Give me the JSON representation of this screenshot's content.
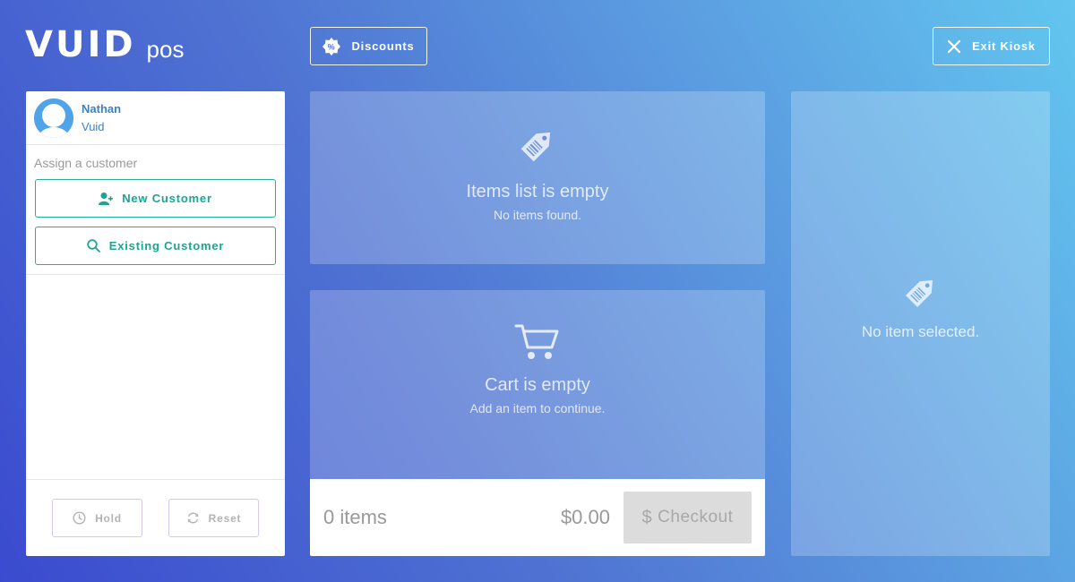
{
  "brand": {
    "logo_text": "VUID",
    "logo_suffix": "pos"
  },
  "header": {
    "discounts_label": "Discounts",
    "exit_label": "Exit Kiosk"
  },
  "user": {
    "name": "Nathan",
    "org": "Vuid"
  },
  "customer": {
    "assign_label": "Assign a customer",
    "new_label": "New Customer",
    "existing_label": "Existing Customer"
  },
  "actions": {
    "hold_label": "Hold",
    "reset_label": "Reset"
  },
  "items_panel": {
    "title": "Items list is empty",
    "subtitle": "No items found."
  },
  "cart_panel": {
    "title": "Cart is empty",
    "subtitle": "Add an item to continue."
  },
  "cart_footer": {
    "item_count": "0 items",
    "total": "$0.00",
    "checkout_label": "Checkout",
    "checkout_symbol": "$"
  },
  "detail_panel": {
    "message": "No item selected."
  },
  "colors": {
    "accent_teal": "#1aa594",
    "user_blue": "#3b82c4",
    "gradient_start": "#3a4bcf",
    "gradient_end": "#62c6ef"
  }
}
